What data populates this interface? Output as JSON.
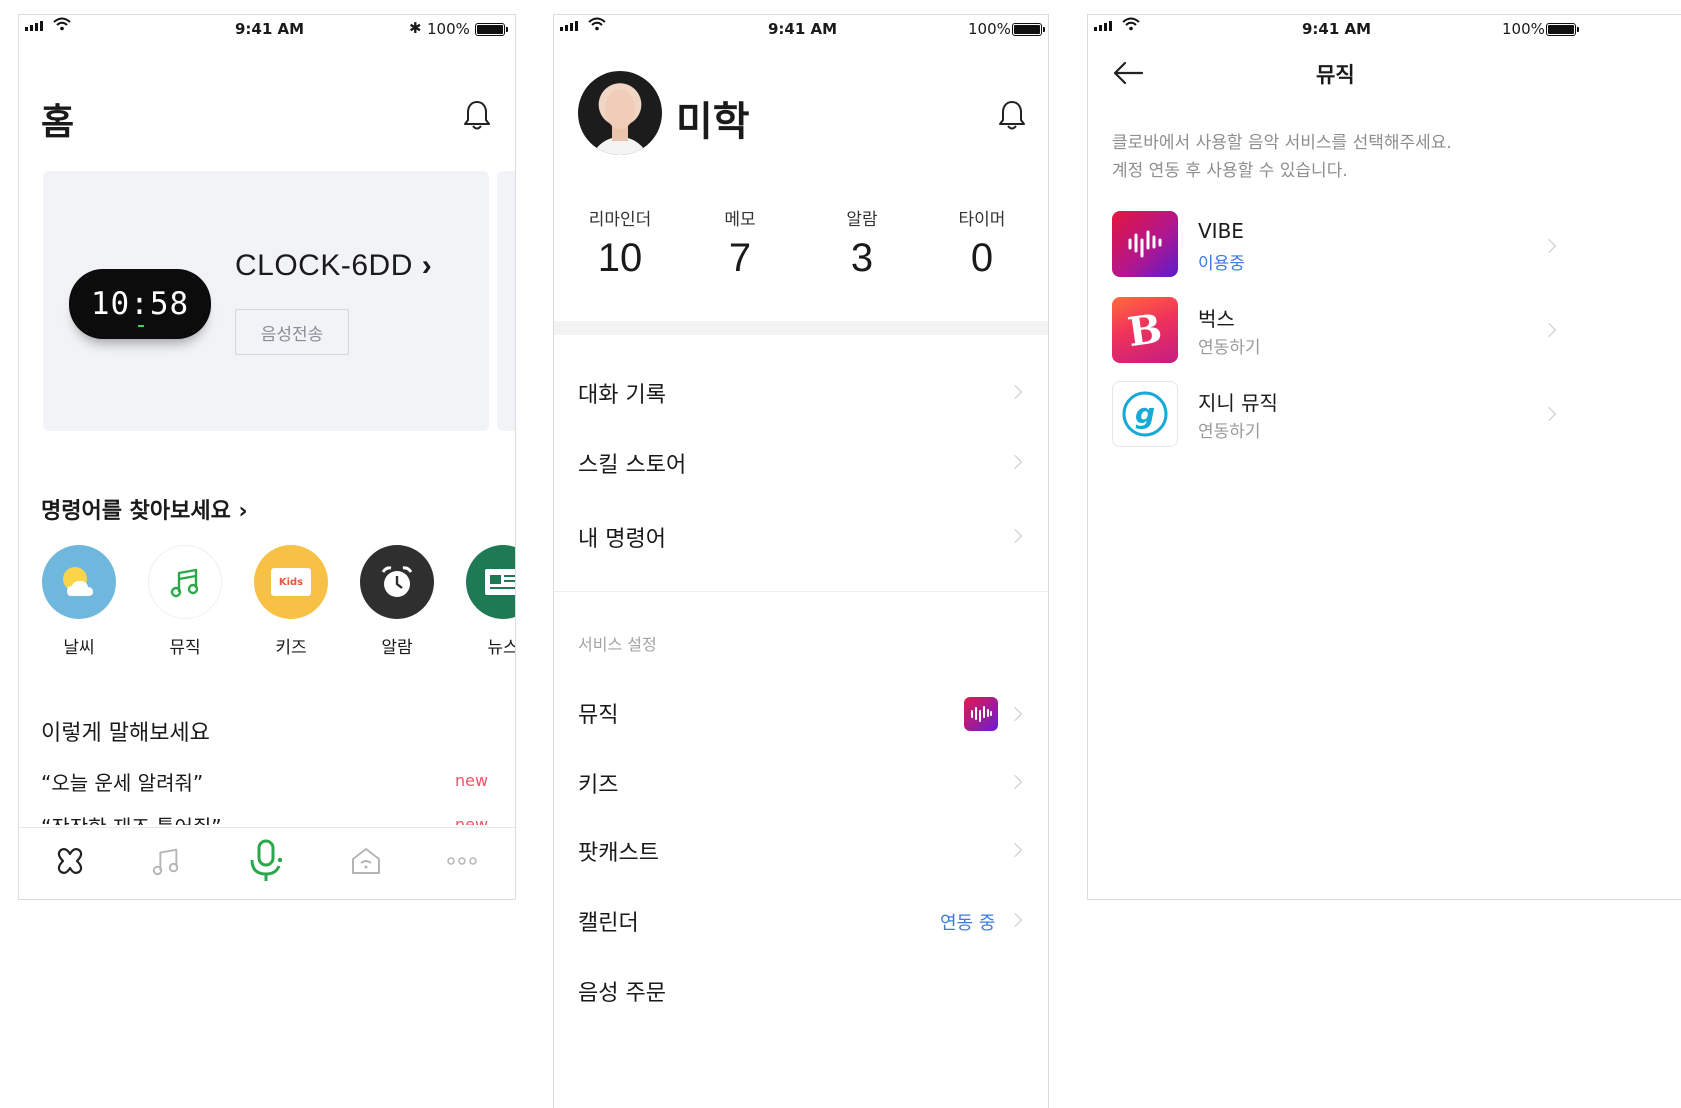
{
  "status_bar": {
    "time": "9:41 AM",
    "battery": "100%"
  },
  "home": {
    "title": "홈",
    "device": {
      "clock_display": "10:58",
      "name": "CLOCK-6DD",
      "name_chevron": "›",
      "voice_button": "음성전송"
    },
    "commands_title": "명령어를 찾아보세요 ›",
    "categories": [
      {
        "label": "날씨",
        "icon": "weather-icon",
        "color": "#6fb7dc"
      },
      {
        "label": "뮤직",
        "icon": "music-icon",
        "color": "#ffffff"
      },
      {
        "label": "키즈",
        "icon": "kids-icon",
        "color": "#f6c144",
        "badge": "Kids"
      },
      {
        "label": "알람",
        "icon": "alarm-icon",
        "color": "#2f2f2f"
      },
      {
        "label": "뉴스",
        "icon": "news-icon",
        "color": "#1e7a55"
      }
    ],
    "say_title": "이렇게 말해보세요",
    "suggestions": [
      {
        "text": "“오늘 운세 알려줘”",
        "tag": "new"
      },
      {
        "text": "“잔잔한 재즈 틀어줘”",
        "tag": "new"
      }
    ],
    "tabs": [
      "clover-icon",
      "music-icon",
      "mic-icon",
      "home-icon",
      "more-icon"
    ]
  },
  "profile": {
    "name": "미학",
    "stats": [
      {
        "label": "리마인더",
        "value": "10"
      },
      {
        "label": "메모",
        "value": "7"
      },
      {
        "label": "알람",
        "value": "3"
      },
      {
        "label": "타이머",
        "value": "0"
      }
    ],
    "menu": [
      "대화 기록",
      "스킬 스토어",
      "내 명령어"
    ],
    "service_header": "서비스 설정",
    "services": [
      {
        "label": "뮤직",
        "extra_icon": "vibe-icon"
      },
      {
        "label": "키즈"
      },
      {
        "label": "팟캐스트"
      },
      {
        "label": "캘린더",
        "status": "연동 중"
      },
      {
        "label": "음성 주문"
      }
    ]
  },
  "music": {
    "title": "뮤직",
    "description_line1": "클로바에서 사용할 음악 서비스를 선택해주세요.",
    "description_line2": "계정 연동 후 사용할 수 있습니다.",
    "apps": [
      {
        "name": "VIBE",
        "status": "이용중",
        "status_color": "#3b7bde",
        "icon": "vibe-icon"
      },
      {
        "name": "벅스",
        "status": "연동하기",
        "status_color": "#9a9a9a",
        "icon": "bugs-icon"
      },
      {
        "name": "지니 뮤직",
        "status": "연동하기",
        "status_color": "#9a9a9a",
        "icon": "genie-icon"
      }
    ]
  }
}
